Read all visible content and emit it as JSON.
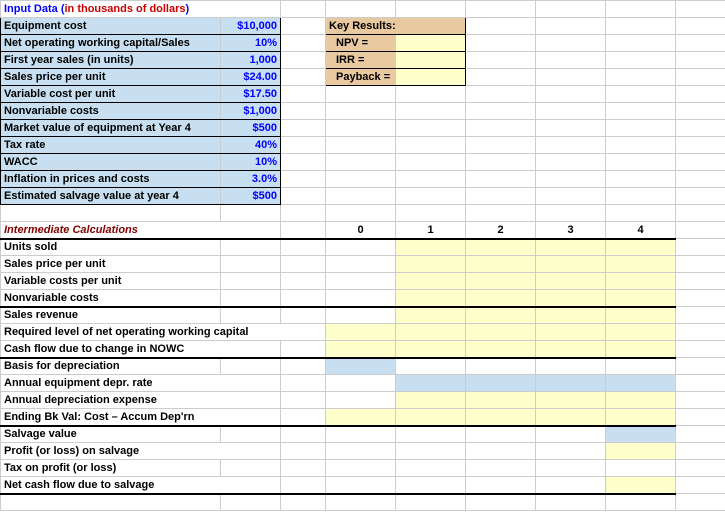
{
  "header": {
    "input_data_prefix": "Input Data (",
    "input_data_red": "in thousands of dollars",
    "input_data_suffix": ")"
  },
  "inputs": {
    "rows": [
      {
        "label": "Equipment  cost",
        "value": "$10,000"
      },
      {
        "label": "Net operating working capital/Sales",
        "value": "10%"
      },
      {
        "label": "First year sales (in units)",
        "value": "1,000"
      },
      {
        "label": "Sales price per unit",
        "value": "$24.00"
      },
      {
        "label": "Variable cost per unit",
        "value": "$17.50"
      },
      {
        "label": "Nonvariable costs",
        "value": "$1,000"
      },
      {
        "label": "Market value of equipment at Year 4",
        "value": "$500"
      },
      {
        "label": "Tax rate",
        "value": "40%"
      },
      {
        "label": "WACC",
        "value": "10%"
      },
      {
        "label": "Inflation in prices and costs",
        "value": "3.0%"
      },
      {
        "label": "Estimated salvage value at year 4",
        "value": "$500"
      }
    ]
  },
  "key_results": {
    "header": "Key Results:",
    "rows": [
      {
        "label": "NPV  =",
        "value": ""
      },
      {
        "label": "IRR    =",
        "value": ""
      },
      {
        "label": "Payback =",
        "value": ""
      }
    ]
  },
  "intermediate": {
    "title": "Intermediate Calculations",
    "years": [
      "0",
      "1",
      "2",
      "3",
      "4"
    ],
    "rows": [
      "Units sold",
      "Sales price per unit",
      "Variable costs per unit",
      "Nonvariable costs",
      "Sales revenue",
      "Required level of net operating working capital",
      "Cash flow due to change in NOWC",
      "Basis for depreciation",
      "Annual equipment depr. rate",
      "Annual depreciation expense",
      "Ending Bk Val: Cost – Accum Dep'rn",
      "Salvage value",
      "Profit (or loss) on salvage",
      "Tax on profit (or loss)",
      "Net cash flow due to salvage"
    ]
  }
}
